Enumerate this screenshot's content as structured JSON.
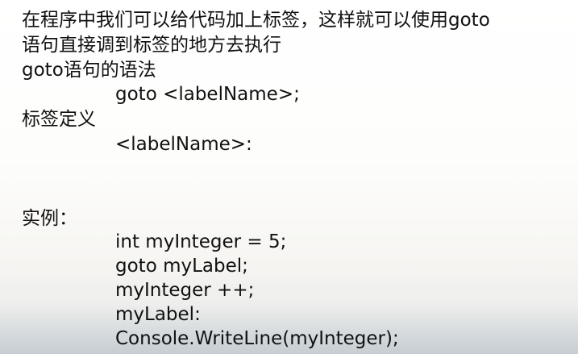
{
  "slide": {
    "intro_line1": "在程序中我们可以给代码加上标签，这样就可以使用goto",
    "intro_line2": "语句直接调到标签的地方去执行",
    "syntax_heading": "goto语句的语法",
    "syntax_code": "goto <labelName>;",
    "label_heading": "标签定义",
    "label_code": "<labelName>:",
    "example_heading": "实例：",
    "example_code": [
      "int myInteger = 5;",
      "goto myLabel;",
      "myInteger ++;",
      "myLabel:",
      "Console.WriteLine(myInteger);"
    ]
  }
}
